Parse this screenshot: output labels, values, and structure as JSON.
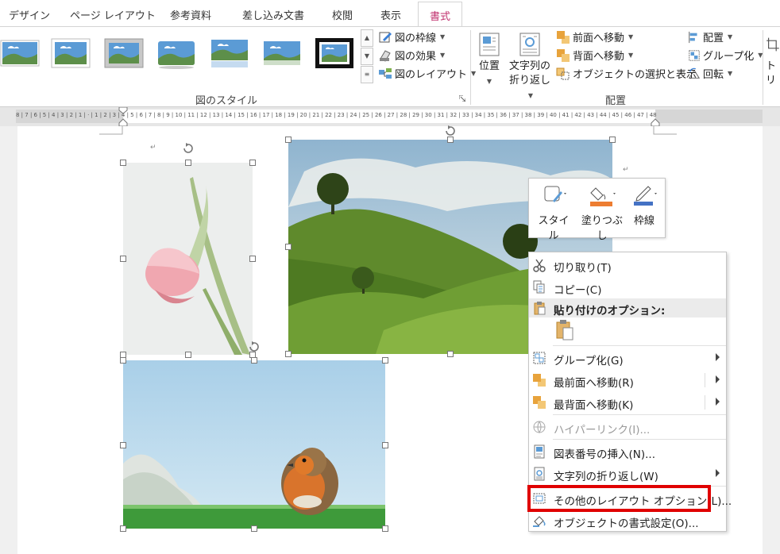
{
  "tabs": [
    {
      "label": "デザイン"
    },
    {
      "label": "ページ レイアウト"
    },
    {
      "label": "参考資料"
    },
    {
      "label": "差し込み文書"
    },
    {
      "label": "校閲"
    },
    {
      "label": "表示"
    },
    {
      "label": "書式",
      "active": true
    }
  ],
  "ribbon": {
    "picture_style_group": {
      "label": "図のスタイル",
      "buttons": {
        "border": "図の枠線",
        "effects": "図の効果",
        "layout": "図のレイアウト"
      }
    },
    "arrange_group": {
      "label": "配置",
      "position": "位置",
      "wrap_line1": "文字列の",
      "wrap_line2": "折り返し",
      "bring_forward": "前面へ移動",
      "send_backward": "背面へ移動",
      "selection_pane": "オブジェクトの選択と表示",
      "align": "配置",
      "group": "グループ化",
      "rotate": "回転"
    },
    "crop_partial": "トリ"
  },
  "ruler": {
    "numbers": "8 | 7 | 6 | 5 | 4 | 3 | 2 | 1 | · | 1 | 2 | 3 | 4 | 5 | 6 | 7 | 8 | 9 | 10 | 11 | 12 | 13 | 14 | 15 | 16 | 17 | 18 | 19 | 20 | 21 | 22 | 23 | 24 | 25 | 26 | 27 | 28 | 29 | 30 | 31 | 32 | 33 | 34 | 35 | 36 | 37 | 38 | 39 | 40 | 41 | 42 | 43 | 44 | 45 | 46 | 47 | 48"
  },
  "mini_toolbar": {
    "style": "スタイル",
    "fill": "塗りつぶし",
    "outline": "枠線"
  },
  "context_menu": {
    "cut": "切り取り(T)",
    "copy": "コピー(C)",
    "paste_options": "貼り付けのオプション:",
    "group": "グループ化(G)",
    "bring_to_front": "最前面へ移動(R)",
    "send_to_back": "最背面へ移動(K)",
    "hyperlink": "ハイパーリンク(I)...",
    "insert_caption": "図表番号の挿入(N)...",
    "wrap_text": "文字列の折り返し(W)",
    "more_layout_options": "その他のレイアウト オプション(L)...",
    "format_object": "オブジェクトの書式設定(O)..."
  },
  "colors": {
    "active_tab": "#c0306e",
    "highlight_border": "#e00000",
    "ribbon_bg": "#ffffff",
    "page_bg": "#f0f0f0"
  },
  "icons": {
    "cut": "scissors-icon",
    "copy": "copy-icon",
    "paste": "clipboard-icon",
    "group": "group-icon",
    "front": "bring-to-front-icon",
    "back": "send-to-back-icon",
    "link": "hyperlink-icon",
    "caption": "caption-icon",
    "wrap": "wrap-text-icon",
    "layout": "layout-options-icon",
    "format": "format-object-icon"
  }
}
